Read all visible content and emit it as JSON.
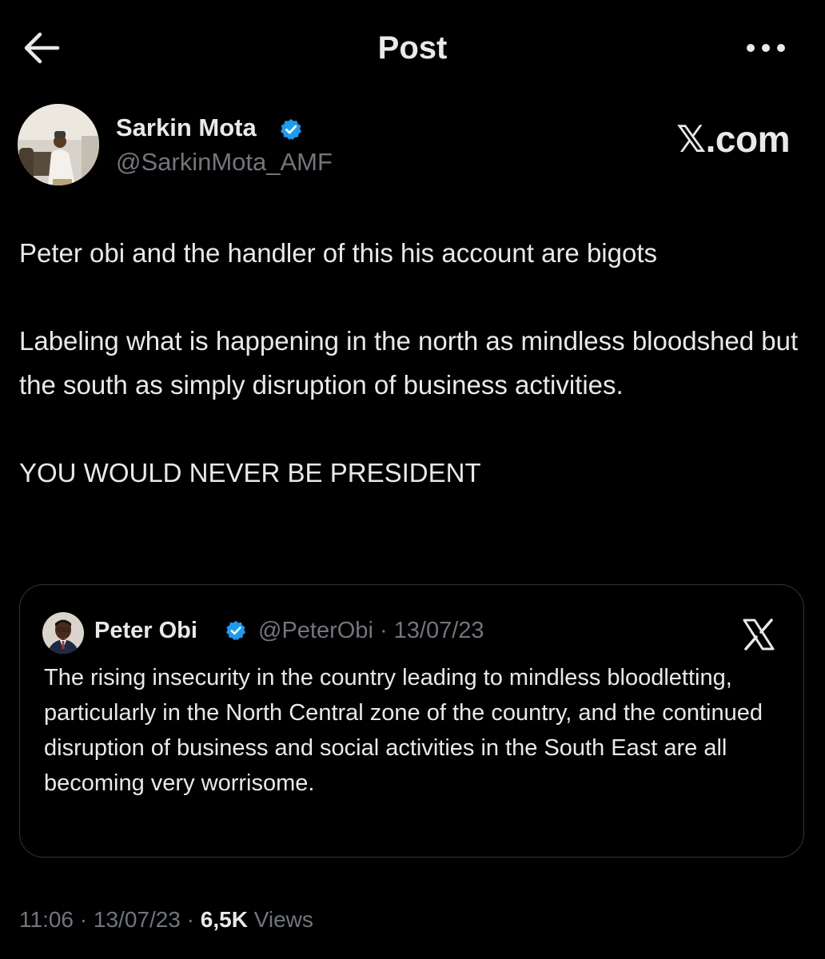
{
  "header": {
    "title": "Post",
    "back_icon": "back-arrow-icon",
    "more_icon": "more-options-icon"
  },
  "author": {
    "name": "Sarkin Mota",
    "handle": "@SarkinMota_AMF",
    "verified": true
  },
  "watermark": "𝕏.com",
  "tweet": {
    "para1": "Peter obi and the handler of this his account are bigots",
    "para2": "Labeling what is happening in the north as mindless bloodshed but the south as simply disruption of business activities.",
    "para3": "YOU WOULD NEVER BE PRESIDENT"
  },
  "quote": {
    "name": "Peter Obi",
    "handle_date": "@PeterObi · 13/07/23",
    "verified": true,
    "text": "The rising insecurity in the country leading to mindless bloodletting, particularly in the North Central zone of the country, and the continued disruption of business and social activities in the South East are all becoming very worrisome."
  },
  "meta": {
    "time": "11:06",
    "sep1": " · ",
    "date": "13/07/23",
    "sep2": " · ",
    "views_count": "6,5K",
    "views_label": " Views"
  },
  "colors": {
    "background": "#000000",
    "text_primary": "#e7e9ea",
    "text_secondary": "#71767b",
    "verified_blue": "#1d9bf0",
    "border": "#2f3336"
  }
}
